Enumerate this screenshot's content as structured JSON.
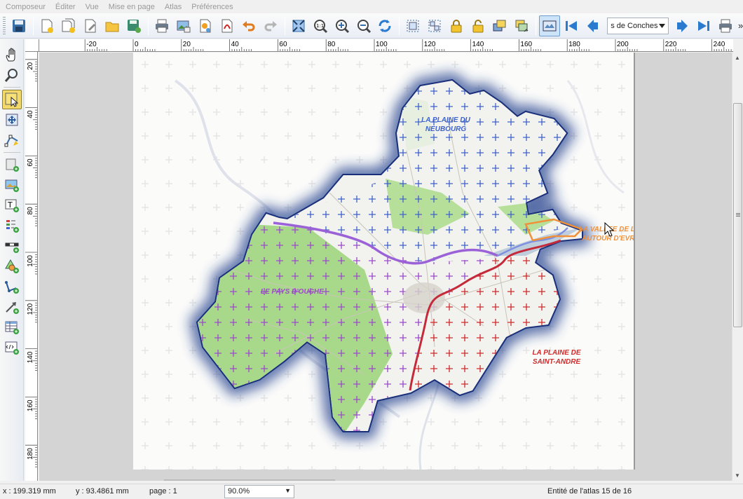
{
  "menubar": {
    "items": [
      "Composeur",
      "Éditer",
      "Vue",
      "Mise en page",
      "Atlas",
      "Préférences"
    ],
    "mnemonics": [
      "C",
      "É",
      "V",
      "M",
      "A",
      "P"
    ]
  },
  "toolbar": {
    "atlas_feature_value": "s de Conches",
    "overflow": "»"
  },
  "ruler": {
    "h_ticks": [
      "-20",
      "0",
      "20",
      "40",
      "60",
      "80",
      "100",
      "120",
      "140",
      "160",
      "180",
      "200",
      "220",
      "240"
    ],
    "v_ticks": [
      "20",
      "40",
      "60",
      "80",
      "100",
      "120",
      "140",
      "160",
      "180"
    ]
  },
  "map": {
    "labels": {
      "neubourg_line1": "LA PLAINE DU",
      "neubourg_line2": "NEUBOURG",
      "ouche": "LE PAYS D'OUCHE",
      "saint_andre_line1": "LA PLAINE DE",
      "saint_andre_line2": "SAINT-ANDRE",
      "vallee_line1": "LA VALLEE DE L'I",
      "vallee_line2": "AUTOUR D'EVR"
    },
    "colors": {
      "neubourg": "#3f63c9",
      "ouche": "#9b49c9",
      "saint_andre": "#cf2b2b",
      "vallee": "#f0913a",
      "land": "#a8d98a",
      "halo": "#1f3a8a"
    }
  },
  "status": {
    "x": "x : 199.319 mm",
    "y": "y : 93.4861 mm",
    "page": "page : 1",
    "zoom": "90.0%",
    "atlas": "Entité de l'atlas 15 de 16"
  }
}
